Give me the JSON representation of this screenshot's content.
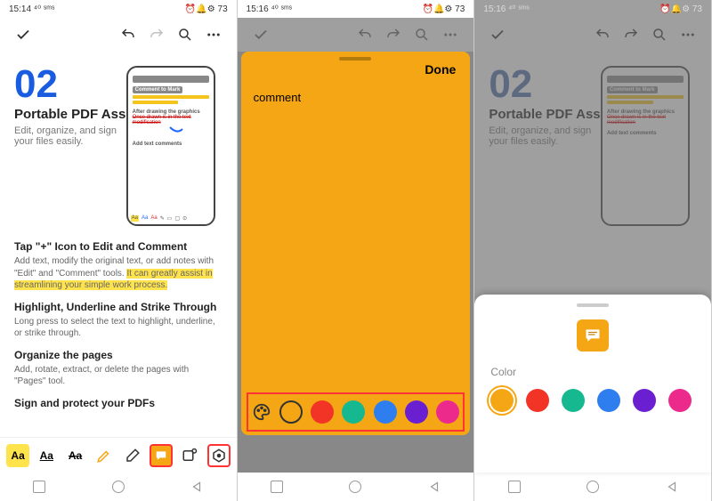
{
  "status": {
    "time1": "15:14 ⁴⁰ ˢᵐˢ",
    "time2": "15:16 ⁴⁰ ˢᵐˢ",
    "time3": "15:16 ⁴⁰ ˢᵐˢ",
    "icons": "⏰🔔⚙ 73"
  },
  "page": {
    "num": "02",
    "title": "Portable PDF Assistant",
    "subtitle": "Edit, organize, and sign your files easily.",
    "mock": {
      "header": "Comment to Mark",
      "sec1": "After drawing the graphics",
      "sec1line": "Once drawn is in the text modification",
      "sec2": "Add text comments"
    },
    "s1h": "Tap \"+\" Icon to Edit and Comment",
    "s1p1": "Add text, modify the original text, or add notes with \"Edit\" and \"Comment\" tools. ",
    "s1hl": "It can greatly assist in streamlining your simple work process.",
    "s2h": "Highlight, Underline and Strike Through",
    "s2p": "Long press to select the text to highlight, underline, or strike through.",
    "s3h": "Organize the pages",
    "s3p": "Add, rotate, extract, or delete the pages with \"Pages\" tool.",
    "s4h": "Sign and protect your PDFs"
  },
  "comment": {
    "done": "Done",
    "placeholder": "comment"
  },
  "colorSheet": {
    "label": "Color"
  },
  "colors": {
    "orange": "#f5a614",
    "red": "#f13426",
    "teal": "#16b88f",
    "blue": "#2f7ef0",
    "purple": "#6a1fd0",
    "pink": "#ec2a8c"
  },
  "tools": {
    "aa": "Aa"
  }
}
